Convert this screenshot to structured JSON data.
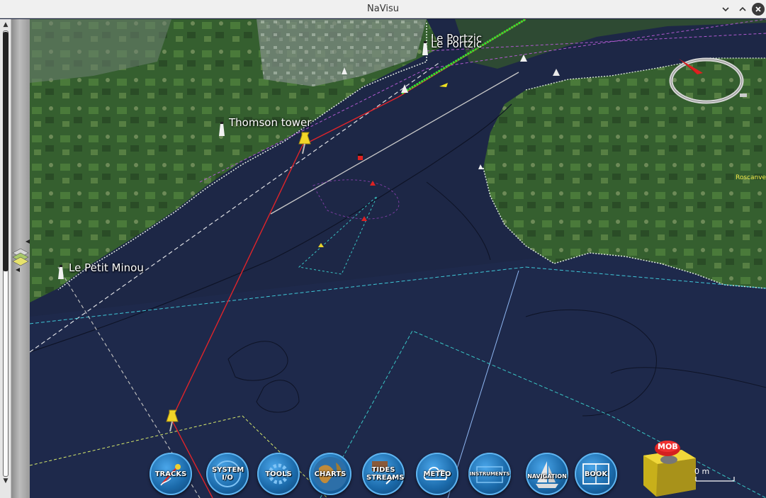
{
  "window": {
    "title": "NaVisu"
  },
  "labels": {
    "portzic": "Le Portzic",
    "portzic_dup": "Le Portzic",
    "thomson": "Thomson tower",
    "petit_minou": "Le Petit Minou",
    "roscanvel": "Roscanvel"
  },
  "toolbar": {
    "tracks": "TRACKS",
    "system_io": "SYSTEM I/O",
    "tools": "TOOLS",
    "charts": "CHARTS",
    "tides_streams": "TIDES STREAMS",
    "meteo": "METEO",
    "instruments": "INSTRUMENTS",
    "navigation": "NAVIGATION",
    "book": "BOOK"
  },
  "mob": {
    "label": "MOB"
  },
  "scale": {
    "text": "0 m"
  },
  "colors": {
    "sea": "#1d2746",
    "land": "#2f5a2c",
    "route": "#e0242a",
    "track": "#37e02f",
    "button": "#1b6aaa"
  }
}
